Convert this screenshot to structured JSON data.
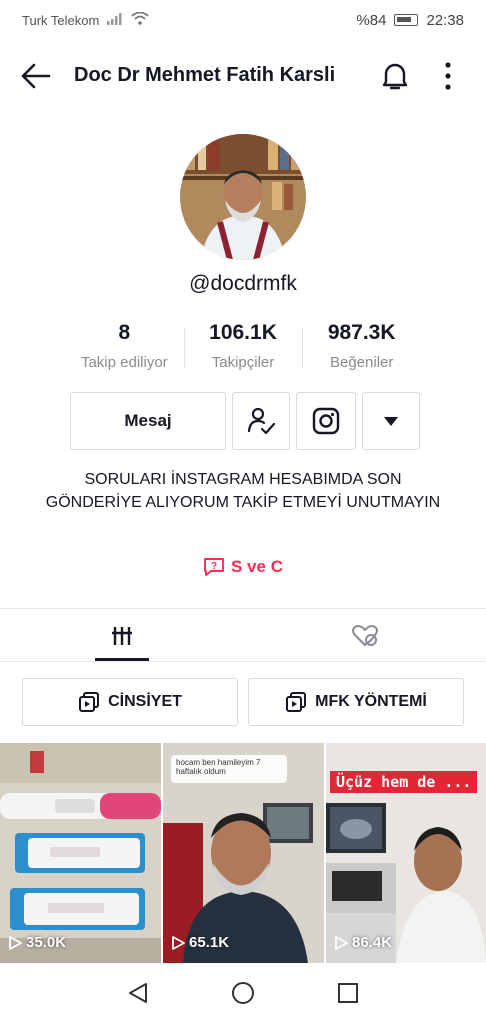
{
  "status": {
    "carrier": "Turk Telekom",
    "battery": "%84",
    "time": "22:38"
  },
  "header": {
    "title": "Doc Dr Mehmet Fatih Karsli"
  },
  "profile": {
    "username": "@docdrmfk",
    "stats": [
      {
        "value": "8",
        "label": "Takip ediliyor"
      },
      {
        "value": "106.1K",
        "label": "Takipçiler"
      },
      {
        "value": "987.3K",
        "label": "Beğeniler"
      }
    ],
    "message_label": "Mesaj",
    "bio": "SORULARI İNSTAGRAM HESABIMDA SON GÖNDERİYE ALIYORUM TAKİP ETMEYİ UNUTMAYIN",
    "link_label": "S ve C"
  },
  "playlists": [
    "CİNSİYET",
    "MFK YÖNTEMİ"
  ],
  "videos": [
    {
      "views": "35.0K"
    },
    {
      "views": "65.1K",
      "caption": "hocam ben hamileyim 7 haftalık oldum"
    },
    {
      "views": "86.4K",
      "banner": "Üçüz hem de ..."
    }
  ],
  "colors": {
    "accent": "#fe2c55",
    "text": "#161823",
    "secondary": "#8a8b91"
  }
}
